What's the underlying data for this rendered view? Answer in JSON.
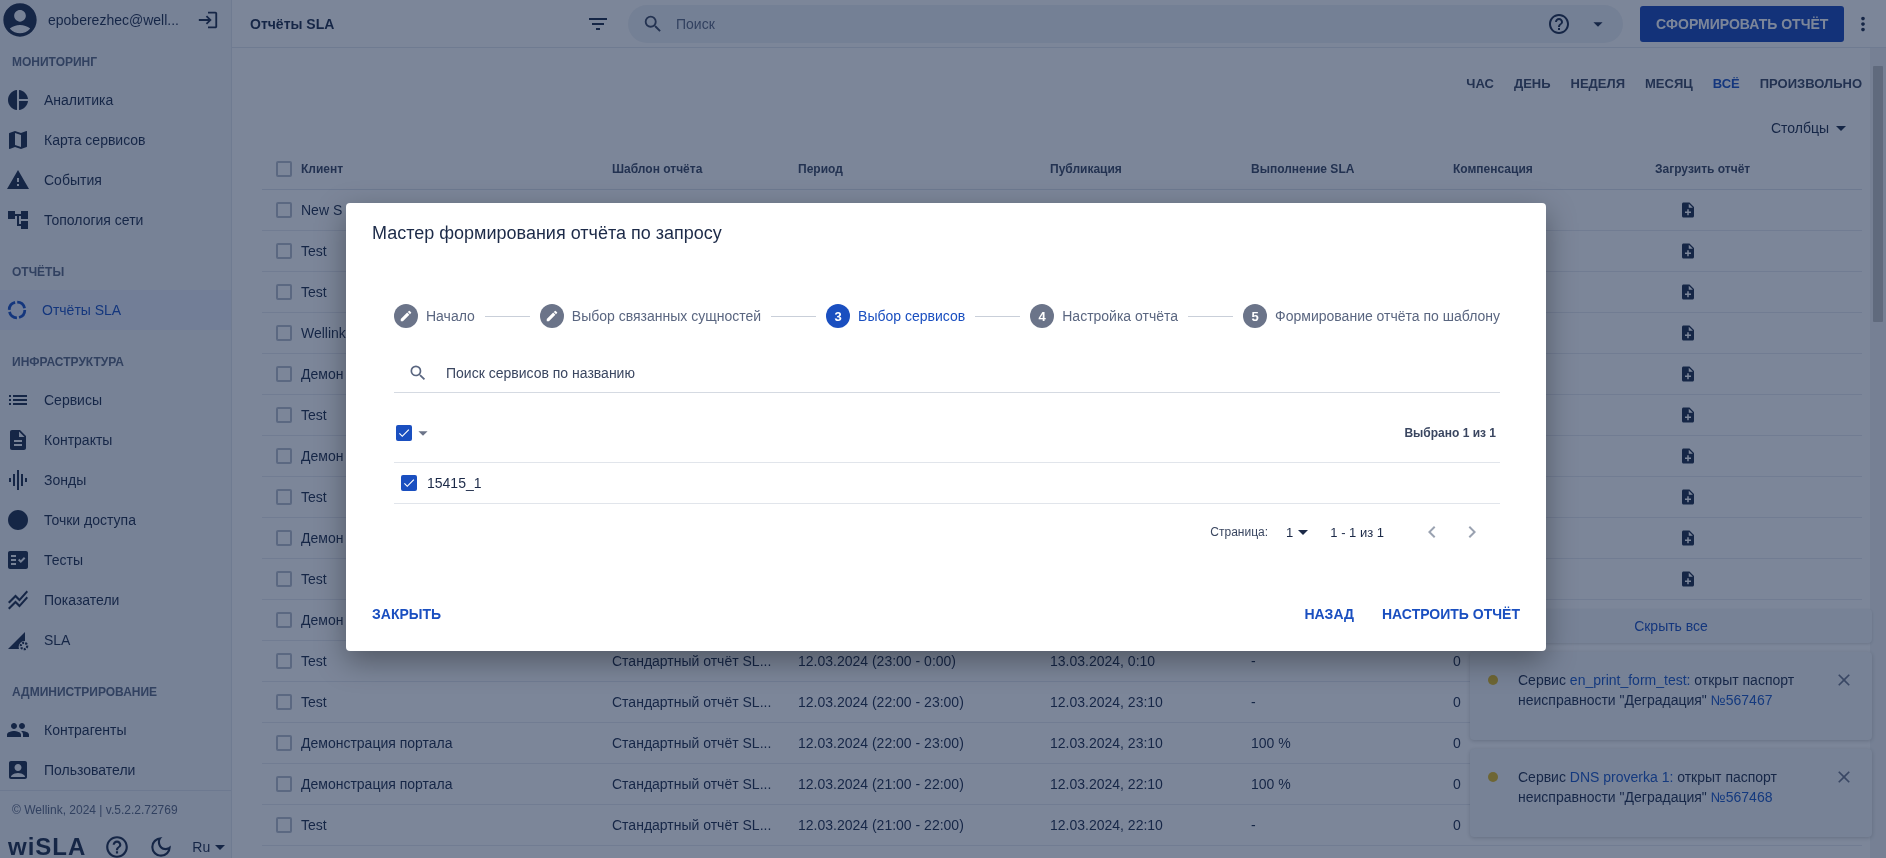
{
  "sidebar": {
    "user": "epoberezhec@well...",
    "sections": [
      {
        "title": "МОНИТОРИНГ",
        "items": [
          {
            "label": "Аналитика",
            "selected": false
          },
          {
            "label": "Карта сервисов",
            "selected": false
          },
          {
            "label": "События",
            "selected": false
          },
          {
            "label": "Топология сети",
            "selected": false
          }
        ]
      },
      {
        "title": "ОТЧЁТЫ",
        "items": [
          {
            "label": "Отчёты SLA",
            "selected": true
          }
        ]
      },
      {
        "title": "ИНФРАСТРУКТУРА",
        "items": [
          {
            "label": "Сервисы",
            "selected": false
          },
          {
            "label": "Контракты",
            "selected": false
          },
          {
            "label": "Зонды",
            "selected": false
          },
          {
            "label": "Точки доступа",
            "selected": false
          },
          {
            "label": "Тесты",
            "selected": false
          },
          {
            "label": "Показатели",
            "selected": false
          },
          {
            "label": "SLA",
            "selected": false
          }
        ]
      },
      {
        "title": "АДМИНИСТРИРОВАНИЕ",
        "items": [
          {
            "label": "Контрагенты",
            "selected": false
          },
          {
            "label": "Пользователи",
            "selected": false
          }
        ]
      }
    ],
    "copyright": "© Wellink, 2024 | v.5.2.2.72769",
    "logo": "wiSLA",
    "language": "Ru"
  },
  "topbar": {
    "title": "Отчёты SLA",
    "search_placeholder": "Поиск",
    "action": "СФОРМИРОВАТЬ ОТЧЁТ"
  },
  "periods": [
    {
      "label": "ЧАС",
      "selected": false
    },
    {
      "label": "ДЕНЬ",
      "selected": false
    },
    {
      "label": "НЕДЕЛЯ",
      "selected": false
    },
    {
      "label": "МЕСЯЦ",
      "selected": false
    },
    {
      "label": "ВСЁ",
      "selected": true
    },
    {
      "label": "ПРОИЗВОЛЬНО",
      "selected": false
    }
  ],
  "columns_menu": "Столбцы",
  "table": {
    "header_checked": false,
    "columns": [
      "Клиент",
      "Шаблон отчёта",
      "Период",
      "Публикация",
      "Выполнение SLA",
      "Компенсация",
      "Загрузить отчёт"
    ],
    "rows": [
      {
        "checked": false,
        "client": "New S",
        "download": true
      },
      {
        "checked": false,
        "client": "Test",
        "download": true
      },
      {
        "checked": false,
        "client": "Test",
        "download": true
      },
      {
        "checked": false,
        "client": "Wellink",
        "download": true
      },
      {
        "checked": false,
        "client": "Демон",
        "download": true
      },
      {
        "checked": false,
        "client": "Test",
        "download": true
      },
      {
        "checked": false,
        "client": "Демон",
        "download": true
      },
      {
        "checked": false,
        "client": "Test",
        "download": true
      },
      {
        "checked": false,
        "client": "Демон",
        "download": true
      },
      {
        "checked": false,
        "client": "Test",
        "download": true
      },
      {
        "checked": false,
        "client": "Демон"
      },
      {
        "checked": false,
        "client": "Test",
        "template": "Стандартный отчёт SL...",
        "period": "12.03.2024 (23:00 - 0:00)",
        "publication": "13.03.2024, 0:10",
        "sla": "-",
        "compensation": "0"
      },
      {
        "checked": false,
        "client": "Test",
        "template": "Стандартный отчёт SL...",
        "period": "12.03.2024 (22:00 - 23:00)",
        "publication": "12.03.2024, 23:10",
        "sla": "-",
        "compensation": "0"
      },
      {
        "checked": false,
        "client": "Демонстрация портала",
        "template": "Стандартный отчёт SL...",
        "period": "12.03.2024 (22:00 - 23:00)",
        "publication": "12.03.2024, 23:10",
        "sla": "100 %",
        "compensation": "0"
      },
      {
        "checked": false,
        "client": "Демонстрация портала",
        "template": "Стандартный отчёт SL...",
        "period": "12.03.2024 (21:00 - 22:00)",
        "publication": "12.03.2024, 22:10",
        "sla": "100 %",
        "compensation": "0"
      },
      {
        "checked": false,
        "client": "Test",
        "template": "Стандартный отчёт SL...",
        "period": "12.03.2024 (21:00 - 22:00)",
        "publication": "12.03.2024, 22:10",
        "sla": "-",
        "compensation": "0"
      }
    ]
  },
  "dialog": {
    "title": "Мастер формирования отчёта по запросу",
    "steps": [
      {
        "label": "Начало",
        "kind": "done"
      },
      {
        "label": "Выбор связанных сущностей",
        "kind": "done"
      },
      {
        "number": "3",
        "label": "Выбор сервисов",
        "kind": "active"
      },
      {
        "number": "4",
        "label": "Настройка отчёта",
        "kind": "pending"
      },
      {
        "number": "5",
        "label": "Формирование отчёта по шаблону",
        "kind": "pending"
      }
    ],
    "search_placeholder": "Поиск сервисов по названию",
    "select_all_checked": true,
    "selected_count": "Выбрано 1 из 1",
    "services": [
      {
        "name": "15415_1",
        "checked": true
      }
    ],
    "page_label": "Страница:",
    "page": "1",
    "range": "1 - 1 из 1",
    "close": "ЗАКРЫТЬ",
    "back": "НАЗАД",
    "next": "НАСТРОИТЬ ОТЧЁТ"
  },
  "notifications": {
    "hide_all": "Скрыть все",
    "items": [
      {
        "parts": [
          {
            "text": "Сервис ",
            "link": false
          },
          {
            "text": "en_print_form_test:",
            "link": true
          },
          {
            "text": " открыт паспорт неисправности \"Деградация\" ",
            "link": false
          },
          {
            "text": "№567467",
            "link": true
          }
        ]
      },
      {
        "parts": [
          {
            "text": "Сервис ",
            "link": false
          },
          {
            "text": "DNS proverka 1:",
            "link": true
          },
          {
            "text": " открыт паспорт неисправности \"Деградация\" ",
            "link": false
          },
          {
            "text": "№567468",
            "link": true
          }
        ]
      }
    ]
  }
}
